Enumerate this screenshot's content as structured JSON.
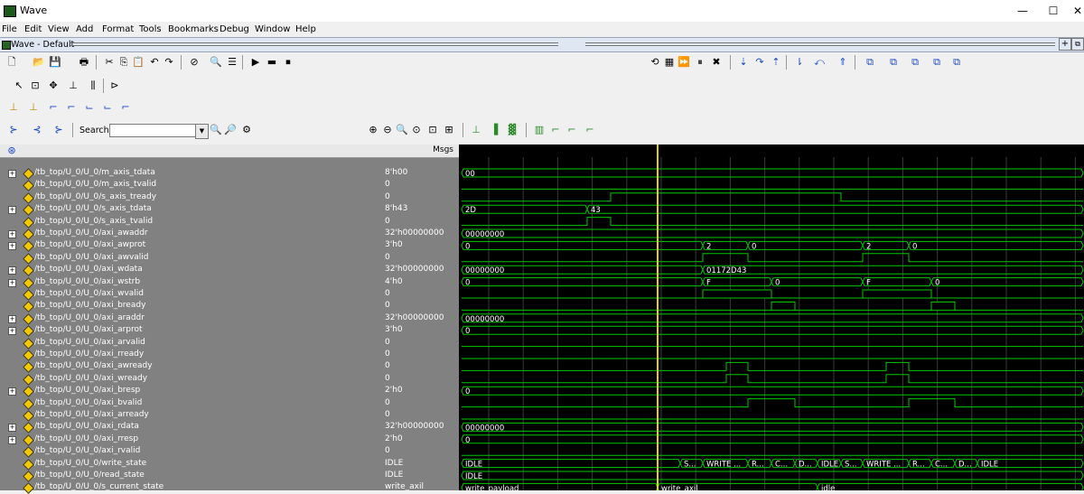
{
  "window": {
    "title": "Wave",
    "minimize": "—",
    "maximize": "☐",
    "close": "✕"
  },
  "menu": [
    "File",
    "Edit",
    "View",
    "Add",
    "Format",
    "Tools",
    "Bookmarks",
    "Debug",
    "Window",
    "Help"
  ],
  "pane": {
    "title": "Wave - Default"
  },
  "search": {
    "label": "Search:",
    "value": ""
  },
  "headers": {
    "values": "Msgs"
  },
  "signals": [
    {
      "name": "/tb_top/U_0/U_0/m_axis_tdata",
      "value": "8'h00",
      "bus": true
    },
    {
      "name": "/tb_top/U_0/U_0/m_axis_tvalid",
      "value": "0",
      "bus": false
    },
    {
      "name": "/tb_top/U_0/U_0/s_axis_tready",
      "value": "0",
      "bus": false
    },
    {
      "name": "/tb_top/U_0/U_0/s_axis_tdata",
      "value": "8'h43",
      "bus": true
    },
    {
      "name": "/tb_top/U_0/U_0/s_axis_tvalid",
      "value": "0",
      "bus": false
    },
    {
      "name": "/tb_top/U_0/U_0/axi_awaddr",
      "value": "32'h00000000",
      "bus": true
    },
    {
      "name": "/tb_top/U_0/U_0/axi_awprot",
      "value": "3'h0",
      "bus": true
    },
    {
      "name": "/tb_top/U_0/U_0/axi_awvalid",
      "value": "0",
      "bus": false
    },
    {
      "name": "/tb_top/U_0/U_0/axi_wdata",
      "value": "32'h00000000",
      "bus": true
    },
    {
      "name": "/tb_top/U_0/U_0/axi_wstrb",
      "value": "4'h0",
      "bus": true
    },
    {
      "name": "/tb_top/U_0/U_0/axi_wvalid",
      "value": "0",
      "bus": false
    },
    {
      "name": "/tb_top/U_0/U_0/axi_bready",
      "value": "0",
      "bus": false
    },
    {
      "name": "/tb_top/U_0/U_0/axi_araddr",
      "value": "32'h00000000",
      "bus": true
    },
    {
      "name": "/tb_top/U_0/U_0/axi_arprot",
      "value": "3'h0",
      "bus": true
    },
    {
      "name": "/tb_top/U_0/U_0/axi_arvalid",
      "value": "0",
      "bus": false
    },
    {
      "name": "/tb_top/U_0/U_0/axi_rready",
      "value": "0",
      "bus": false
    },
    {
      "name": "/tb_top/U_0/U_0/axi_awready",
      "value": "0",
      "bus": false
    },
    {
      "name": "/tb_top/U_0/U_0/axi_wready",
      "value": "0",
      "bus": false
    },
    {
      "name": "/tb_top/U_0/U_0/axi_bresp",
      "value": "2'h0",
      "bus": true
    },
    {
      "name": "/tb_top/U_0/U_0/axi_bvalid",
      "value": "0",
      "bus": false
    },
    {
      "name": "/tb_top/U_0/U_0/axi_arready",
      "value": "0",
      "bus": false
    },
    {
      "name": "/tb_top/U_0/U_0/axi_rdata",
      "value": "32'h00000000",
      "bus": true
    },
    {
      "name": "/tb_top/U_0/U_0/axi_rresp",
      "value": "2'h0",
      "bus": true
    },
    {
      "name": "/tb_top/U_0/U_0/axi_rvalid",
      "value": "0",
      "bus": false
    },
    {
      "name": "/tb_top/U_0/U_0/write_state",
      "value": "IDLE",
      "bus": false
    },
    {
      "name": "/tb_top/U_0/U_0/read_state",
      "value": "IDLE",
      "bus": false
    },
    {
      "name": "/tb_top/U_0/U_0/s_current_state",
      "value": "write_axil",
      "bus": false
    }
  ],
  "wave_labels": {
    "m_axis_tdata": "00",
    "s_axis_tdata_a": "2D",
    "s_axis_tdata_b": "43",
    "axi_awaddr": "00000000",
    "axi_awprot_a": "0",
    "axi_awprot_b": "2",
    "axi_awprot_c": "0",
    "axi_awprot_d": "2",
    "axi_awprot_e": "0",
    "axi_wdata_a": "00000000",
    "axi_wdata_b": "01172D43",
    "axi_wstrb_a": "0",
    "axi_wstrb_b": "F",
    "axi_wstrb_c": "0",
    "axi_wstrb_d": "F",
    "axi_wstrb_e": "0",
    "axi_araddr": "00000000",
    "axi_arprot": "0",
    "axi_bresp": "0",
    "axi_rdata": "00000000",
    "axi_rresp": "0",
    "write_state": [
      "IDLE",
      "S...",
      "WRITE ...",
      "R...",
      "C...",
      "D...",
      "IDLE",
      "S...",
      "WRITE ...",
      "R...",
      "C...",
      "D...",
      "IDLE"
    ],
    "read_state": "IDLE",
    "s_current_state": [
      "write_payload",
      "write_axil",
      "idle"
    ]
  },
  "colors": {
    "wave": "#00c800",
    "cursor": "#e6d000",
    "grid": "#3a3a3a",
    "panel": "#818181",
    "wave_bg": "#000000"
  },
  "icons": [
    "new-icon",
    "open-icon",
    "save-icon",
    "print-icon",
    "cut-icon",
    "copy-icon",
    "paste-icon",
    "undo-icon",
    "redo-icon",
    "find-icon",
    "zoom-in-icon",
    "zoom-out-icon",
    "zoom-full-icon",
    "cursor-icon",
    "edge-icon"
  ]
}
